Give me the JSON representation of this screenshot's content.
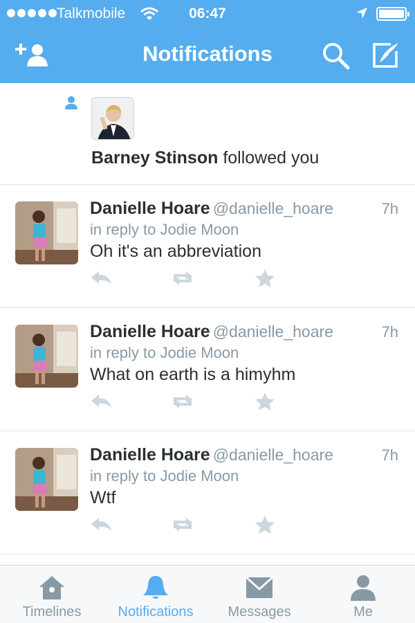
{
  "status_bar": {
    "carrier": "Talkmobile",
    "time": "06:47"
  },
  "nav": {
    "title": "Notifications",
    "left_icon": "add-user-icon",
    "right_icons": [
      "search-icon",
      "compose-icon"
    ],
    "accent_color": "#55acee"
  },
  "follow_notification": {
    "name": "Barney Stinson",
    "action": " followed you"
  },
  "tweets": [
    {
      "name": "Danielle Hoare",
      "handle": "@danielle_hoare",
      "time": "7h",
      "reply_to": "in reply to Jodie Moon",
      "text": "Oh it's an abbreviation"
    },
    {
      "name": "Danielle Hoare",
      "handle": "@danielle_hoare",
      "time": "7h",
      "reply_to": "in reply to Jodie Moon",
      "text": "What on earth is a himyhm"
    },
    {
      "name": "Danielle Hoare",
      "handle": "@danielle_hoare",
      "time": "7h",
      "reply_to": "in reply to Jodie Moon",
      "text": "Wtf"
    }
  ],
  "tabs": [
    {
      "label": "Timelines",
      "icon": "home-icon"
    },
    {
      "label": "Notifications",
      "icon": "bell-icon",
      "active": true
    },
    {
      "label": "Messages",
      "icon": "envelope-icon"
    },
    {
      "label": "Me",
      "icon": "person-icon"
    }
  ]
}
